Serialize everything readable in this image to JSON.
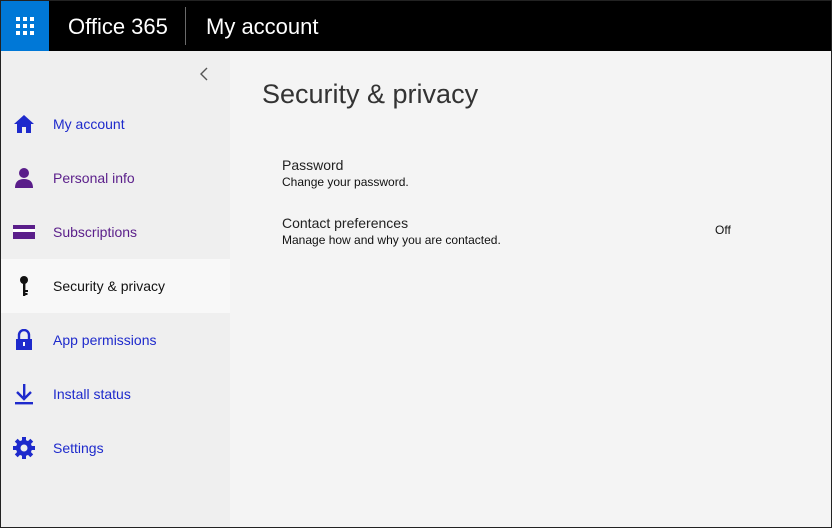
{
  "header": {
    "brand": "Office 365",
    "app_title": "My account"
  },
  "sidebar": {
    "items": [
      {
        "label": "My account",
        "icon": "home-icon"
      },
      {
        "label": "Personal info",
        "icon": "person-icon"
      },
      {
        "label": "Subscriptions",
        "icon": "card-icon"
      },
      {
        "label": "Security & privacy",
        "icon": "key-icon",
        "selected": true
      },
      {
        "label": "App permissions",
        "icon": "lock-icon"
      },
      {
        "label": "Install status",
        "icon": "download-icon"
      },
      {
        "label": "Settings",
        "icon": "gear-icon"
      }
    ]
  },
  "main": {
    "title": "Security & privacy",
    "settings": [
      {
        "title": "Password",
        "description": "Change your password."
      },
      {
        "title": "Contact preferences",
        "description": "Manage how and why you are contacted.",
        "status": "Off"
      }
    ]
  },
  "colors": {
    "accent": "#0078d7",
    "link": "#1e2acc",
    "purple": "#5a1e8a",
    "topbar": "#000000"
  }
}
